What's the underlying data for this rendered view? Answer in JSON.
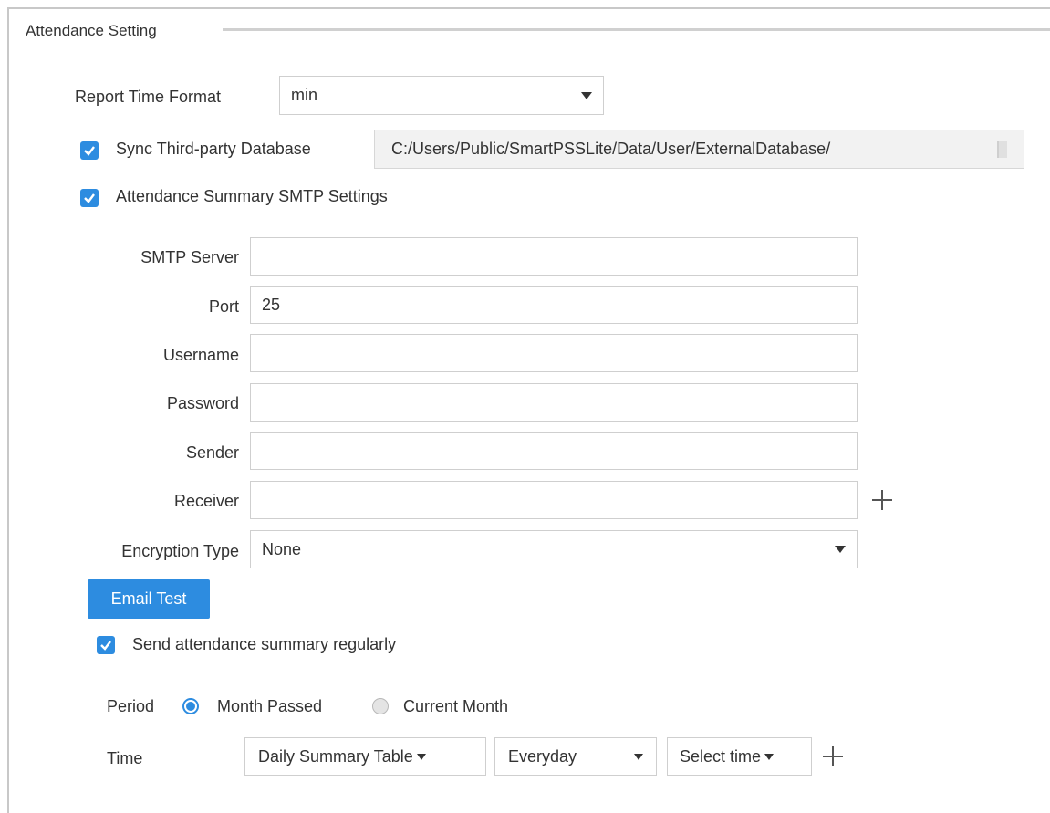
{
  "section": {
    "title": "Attendance Setting"
  },
  "report_time_format": {
    "label": "Report Time Format",
    "value": "min"
  },
  "sync_database": {
    "label": "Sync Third-party Database",
    "checked": true,
    "path": "C:/Users/Public/SmartPSSLite/Data/User/ExternalDatabase/"
  },
  "smtp_settings": {
    "label": "Attendance Summary SMTP Settings",
    "checked": true,
    "fields": {
      "smtp_server": {
        "label": "SMTP Server",
        "value": ""
      },
      "port": {
        "label": "Port",
        "value": "25"
      },
      "username": {
        "label": "Username",
        "value": ""
      },
      "password": {
        "label": "Password",
        "value": ""
      },
      "sender": {
        "label": "Sender",
        "value": ""
      },
      "receiver": {
        "label": "Receiver",
        "value": ""
      }
    },
    "encryption": {
      "label": "Encryption Type",
      "value": "None"
    },
    "email_test_label": "Email Test"
  },
  "send_regularly": {
    "label": "Send attendance summary regularly",
    "checked": true
  },
  "period": {
    "label": "Period",
    "options": [
      "Month Passed",
      "Current Month"
    ],
    "selected": "Month Passed"
  },
  "time": {
    "label": "Time",
    "table_type": "Daily Summary Table",
    "frequency": "Everyday",
    "select_time": "Select time"
  },
  "colors": {
    "accent": "#2d8ce0"
  },
  "icons": {
    "checkbox": "checkmark-icon",
    "dropdown": "caret-down-icon",
    "add": "plus-icon",
    "browse": "browse-icon"
  }
}
